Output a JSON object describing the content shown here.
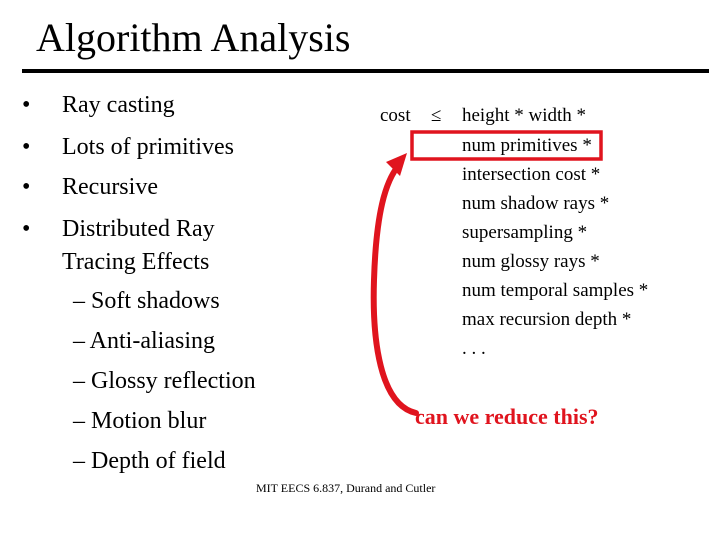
{
  "slide": {
    "title": "Algorithm Analysis",
    "bullets": [
      {
        "text": "Ray casting"
      },
      {
        "text": "Lots of primitives"
      },
      {
        "text": "Recursive"
      },
      {
        "text": "Distributed Ray"
      },
      {
        "text": "Tracing Effects"
      }
    ],
    "bullet_glyph": "•",
    "sub_bullets": [
      {
        "text": "– Soft shadows"
      },
      {
        "text": "– Anti-aliasing"
      },
      {
        "text": "– Glossy reflection"
      },
      {
        "text": "– Motion blur"
      },
      {
        "text": "– Depth of field"
      }
    ],
    "cost_formula": {
      "lhs": "cost",
      "relation": "≤",
      "terms": [
        "height * width *",
        "num primitives *",
        "intersection cost *",
        "num shadow rays *",
        "supersampling *",
        "num glossy rays *",
        "num temporal samples *",
        "max recursion depth *",
        ". . ."
      ]
    },
    "callout": {
      "text": "can we reduce this?",
      "color": "#e0141e"
    },
    "footer": "MIT EECS 6.837, Durand and Cutler"
  }
}
